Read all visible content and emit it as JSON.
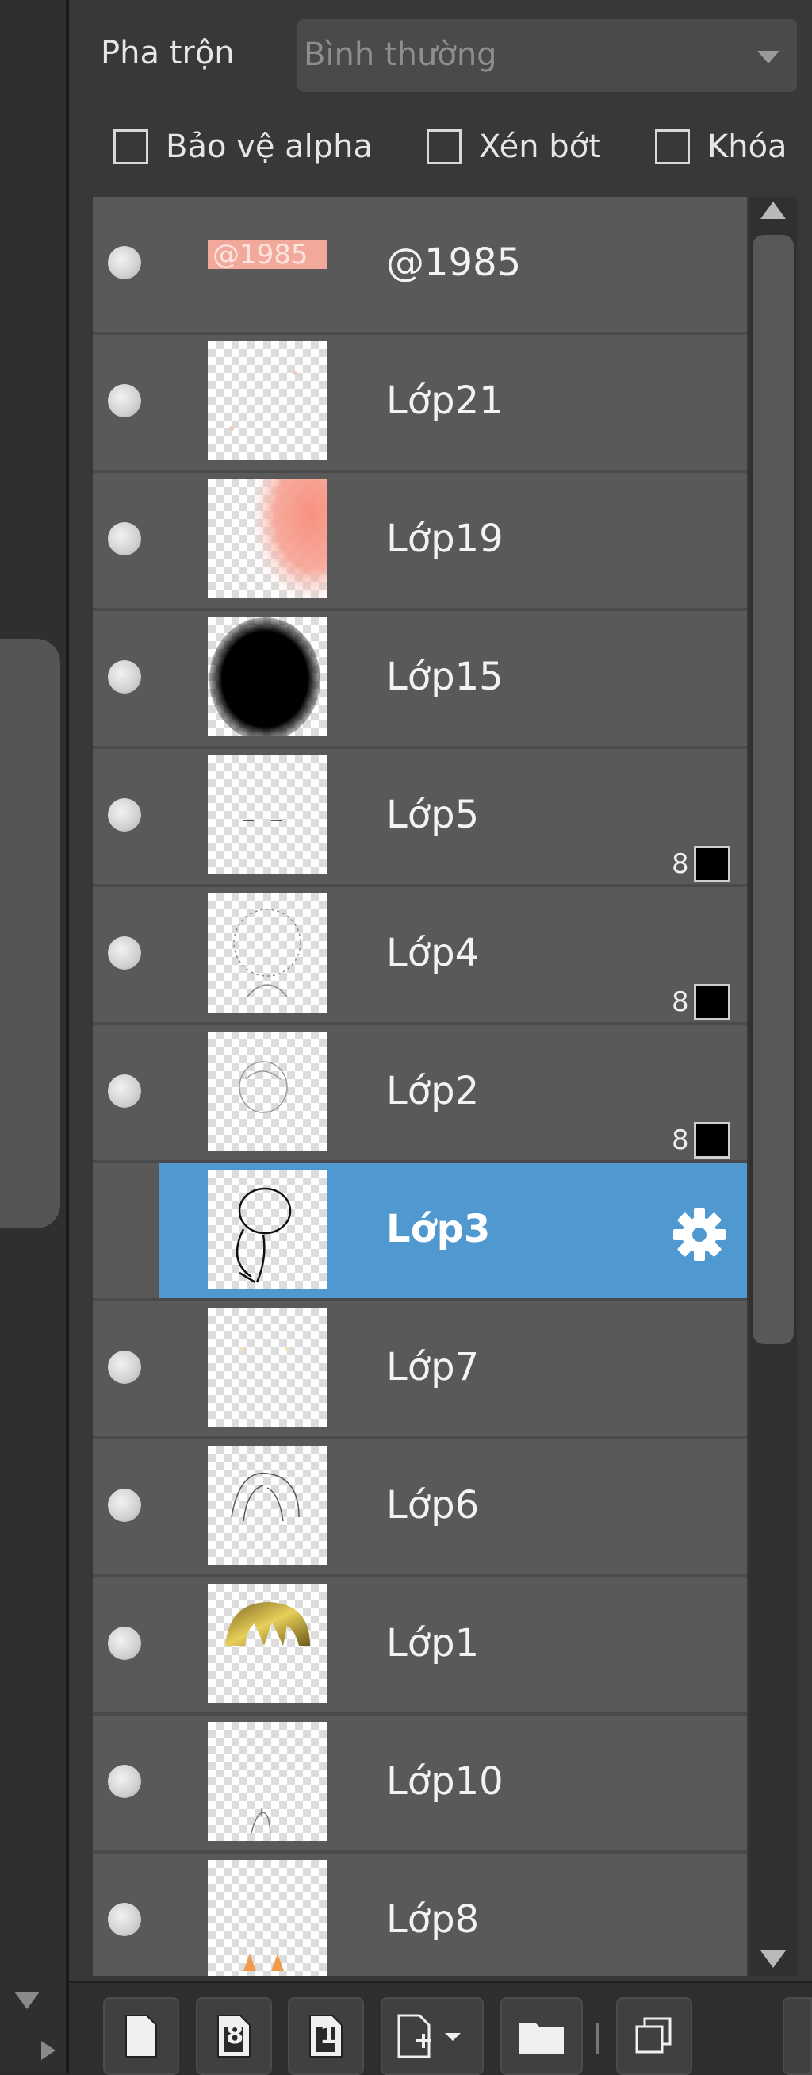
{
  "blend": {
    "label": "Pha trộn",
    "value": "Bình thường"
  },
  "options": {
    "protect_alpha": "Bảo vệ alpha",
    "clipping": "Xén bớt",
    "lock": "Khóa"
  },
  "layers": [
    {
      "name": "@1985",
      "thumb_text": "@1985",
      "visible": true
    },
    {
      "name": "Lớp21",
      "visible": true
    },
    {
      "name": "Lớp19",
      "visible": true
    },
    {
      "name": "Lớp15",
      "visible": true
    },
    {
      "name": "Lớp5",
      "visible": true,
      "badge": "8"
    },
    {
      "name": "Lớp4",
      "visible": true,
      "badge": "8"
    },
    {
      "name": "Lớp2",
      "visible": true,
      "badge": "8"
    },
    {
      "name": "Lớp3",
      "visible": true,
      "selected": true
    },
    {
      "name": "Lớp7",
      "visible": true
    },
    {
      "name": "Lớp6",
      "visible": true
    },
    {
      "name": "Lớp1",
      "visible": true
    },
    {
      "name": "Lớp10",
      "visible": true
    },
    {
      "name": "Lớp8",
      "visible": true
    }
  ],
  "toolbar": {
    "new_layer_badge": "8",
    "new_1bit_badge": "1"
  },
  "colors": {
    "selection": "#4f98d0",
    "row": "#595959",
    "panel": "#383838"
  },
  "icons": [
    "eye-icon",
    "gear-icon",
    "new-layer-icon",
    "new-8bit-layer-icon",
    "new-1bit-layer-icon",
    "add-layer-menu-icon",
    "folder-icon",
    "duplicate-layer-icon"
  ]
}
